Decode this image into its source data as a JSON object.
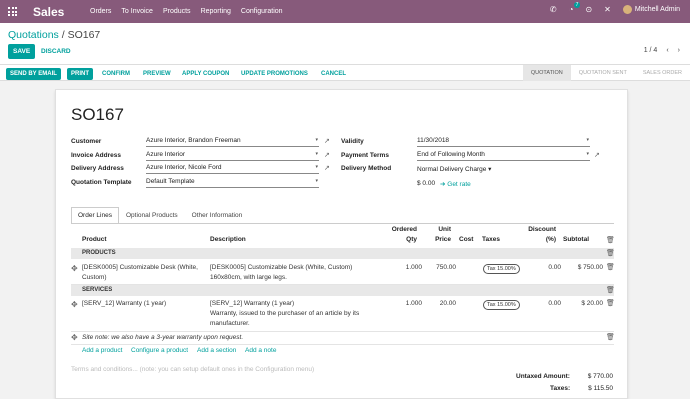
{
  "navbar": {
    "app_name": "Sales",
    "menu": [
      "Orders",
      "To Invoice",
      "Products",
      "Reporting",
      "Configuration"
    ],
    "chat_badge": "7",
    "user_name": "Mitchell Admin"
  },
  "control_panel": {
    "breadcrumb_parent": "Quotations",
    "breadcrumb_sep": "/",
    "breadcrumb_current": "SO167",
    "save_label": "SAVE",
    "discard_label": "DISCARD",
    "pager": "1 / 4",
    "prev_icon": "‹",
    "next_icon": "›"
  },
  "statusbar": {
    "buttons": [
      "SEND BY EMAIL",
      "PRINT",
      "CONFIRM",
      "PREVIEW",
      "APPLY COUPON",
      "UPDATE PROMOTIONS",
      "CANCEL"
    ],
    "stages": [
      "QUOTATION",
      "QUOTATION SENT",
      "SALES ORDER"
    ],
    "active_stage": "QUOTATION"
  },
  "form": {
    "title": "SO167",
    "customer_label": "Customer",
    "customer_value": "Azure Interior, Brandon Freeman",
    "invoice_address_label": "Invoice Address",
    "invoice_address_value": "Azure Interior",
    "delivery_address_label": "Delivery Address",
    "delivery_address_value": "Azure Interior, Nicole Ford",
    "template_label": "Quotation Template",
    "template_value": "Default Template",
    "validity_label": "Validity",
    "validity_value": "11/30/2018",
    "payment_terms_label": "Payment Terms",
    "payment_terms_value": "End of Following Month",
    "delivery_method_label": "Delivery Method",
    "delivery_method_value": "Normal Delivery Charge",
    "delivery_cost": "$ 0.00",
    "get_rate": "Get rate"
  },
  "tabs": [
    "Order Lines",
    "Optional Products",
    "Other Information"
  ],
  "order_lines": {
    "headers": {
      "product": "Product",
      "description": "Description",
      "qty_line1": "Ordered",
      "qty_line2": "Qty",
      "price_line1": "Unit",
      "price_line2": "Price",
      "cost": "Cost",
      "taxes": "Taxes",
      "discount_line1": "Discount",
      "discount_line2": "(%)",
      "subtotal": "Subtotal"
    },
    "section_products": "PRODUCTS",
    "line1": {
      "product_l1": "[DESK0005] Customizable Desk (White,",
      "product_l2": "Custom)",
      "description_l1": "[DESK0005] Customizable Desk (White, Custom)",
      "description_l2": "160x80cm, with large legs.",
      "qty": "1.000",
      "price": "750.00",
      "tax": "Tax 15.00%",
      "discount": "0.00",
      "subtotal": "$ 750.00"
    },
    "section_services": "SERVICES",
    "line2": {
      "product": "[SERV_12] Warranty (1 year)",
      "description_l1": "[SERV_12] Warranty (1 year)",
      "description_l2": "Warranty, issued to the purchaser of an article by its",
      "description_l3": "manufacturer.",
      "qty": "1.000",
      "price": "20.00",
      "tax": "Tax 15.00%",
      "discount": "0.00",
      "subtotal": "$ 20.00"
    },
    "note": "Site note: we also have a 3-year warranty upon request.",
    "add_product": "Add a product",
    "configure_product": "Configure a product",
    "add_section": "Add a section",
    "add_note": "Add a note"
  },
  "terms_placeholder": "Terms and conditions... (note: you can setup default ones in the Configuration menu)",
  "totals": {
    "untaxed_label": "Untaxed Amount:",
    "untaxed_value": "$ 770.00",
    "taxes_label": "Taxes:",
    "taxes_value": "$ 115.50"
  },
  "icons": {
    "apps": "grid-icon",
    "phone": "✆",
    "chat": "◔",
    "activity": "⊙",
    "close": "✕",
    "external": "↗",
    "dropdown": "▾",
    "drag": "✥",
    "trash": "🗑",
    "arrow": "➔"
  }
}
